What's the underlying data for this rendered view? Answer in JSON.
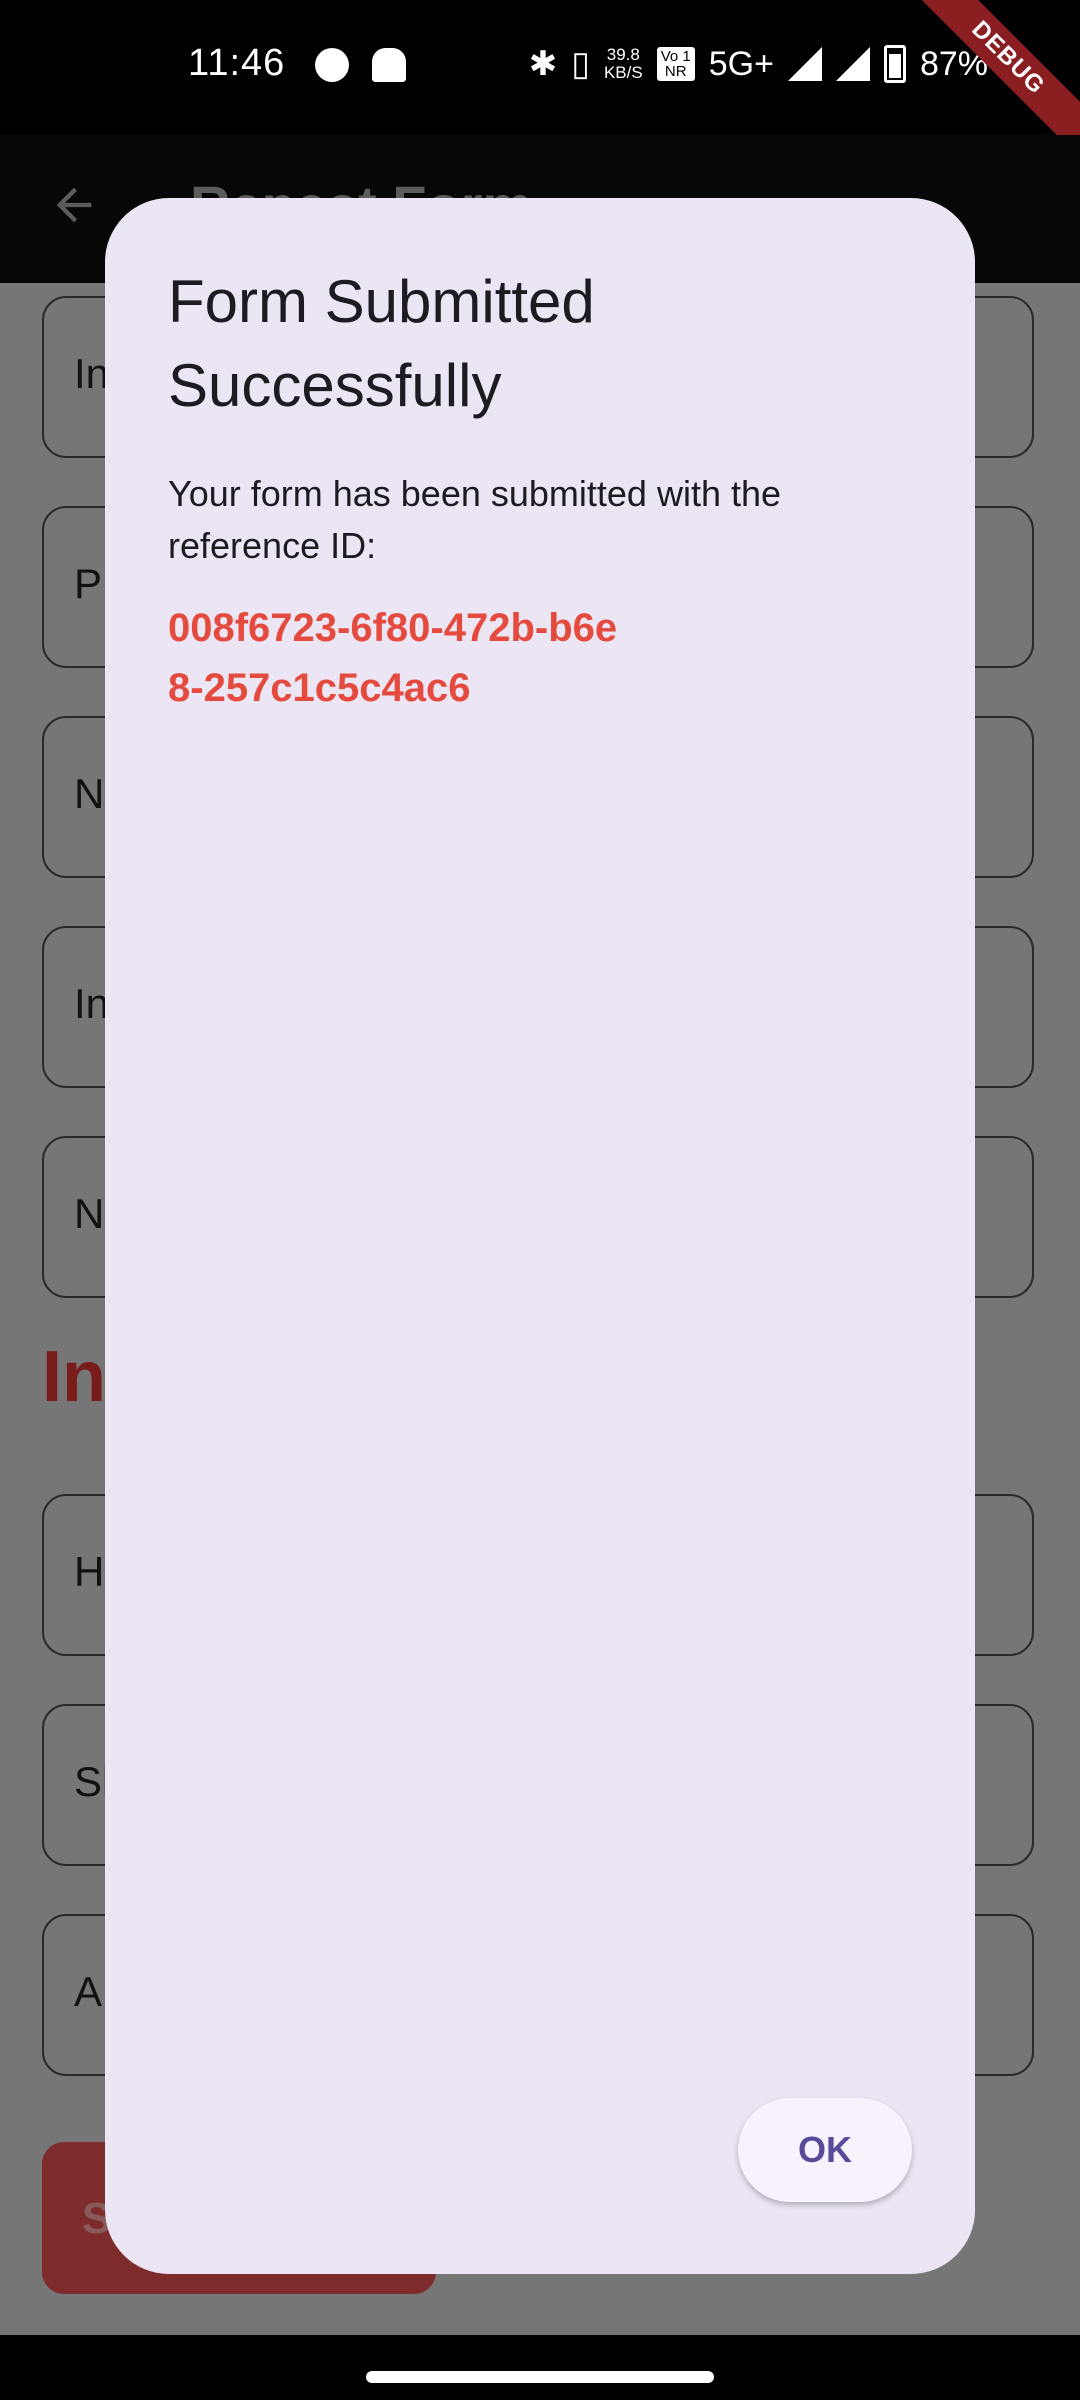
{
  "status_bar": {
    "time": "11:46",
    "net_speed_value": "39.8",
    "net_speed_unit": "KB/S",
    "volte_top": "Vo 1",
    "volte_bottom": "NR",
    "network_type": "5G+",
    "battery": "87%",
    "debug_label": "DEBUG"
  },
  "app_bar": {
    "title": "Repeat Form"
  },
  "background_form": {
    "fields": [
      {
        "label_visible": "In"
      },
      {
        "label_visible": "P"
      },
      {
        "label_visible": "N"
      },
      {
        "label_visible": "In"
      },
      {
        "label_visible": "N"
      },
      {
        "label_visible": "H"
      },
      {
        "label_visible": "Sl"
      },
      {
        "label_visible": "A"
      }
    ],
    "section_heading": "In",
    "submit_label": "S"
  },
  "dialog": {
    "title": "Form Submitted Successfully",
    "message": "Your form has been submitted with the reference ID:",
    "reference_id": "008f6723-6f80-472b-b6e8-257c1c5c4ac6",
    "ok_label": "OK"
  },
  "colors": {
    "dialog_bg": "#ece6f4",
    "reference_id": "#e44a3d",
    "ok_text": "#5a4a9a",
    "debug_ribbon": "#8b1e21"
  }
}
